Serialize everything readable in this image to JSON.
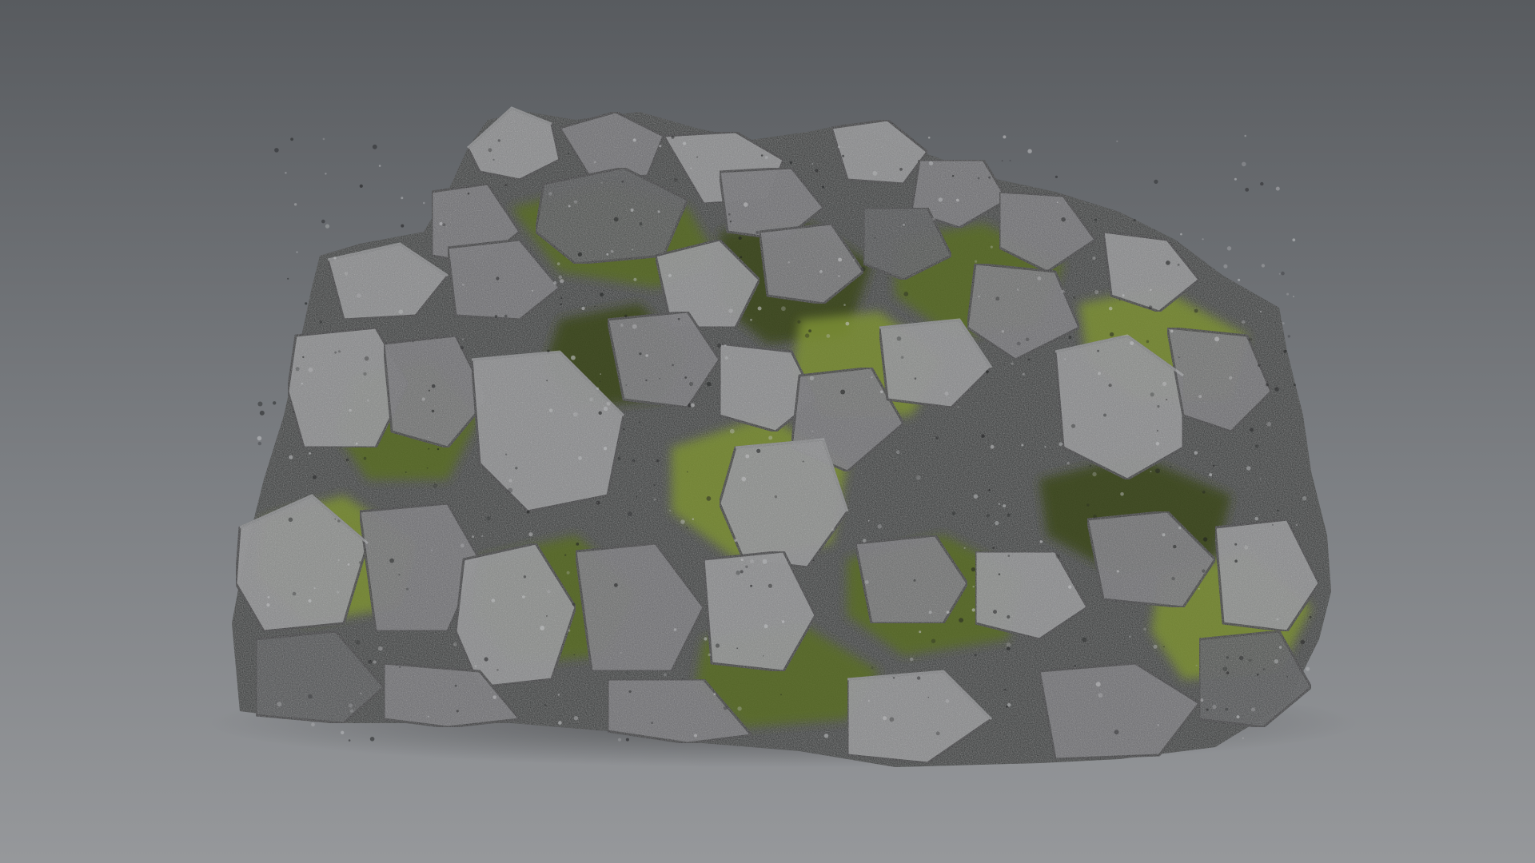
{
  "render": {
    "subject": "mossy-rock-pile",
    "background": {
      "top_color": "#585b5f",
      "middle_color": "#7c7f83",
      "bottom_color": "#96989b"
    },
    "palette": {
      "rock_dark": "#2f3032",
      "rock_mid": "#4c4d50",
      "rock_light": "#6f7073",
      "rock_highlight": "#8c8d8f",
      "moss_dark": "#3d4a1e",
      "moss_mid": "#5a6d26",
      "moss_light": "#7b8f35",
      "shadow": "#2a2b2d"
    }
  }
}
